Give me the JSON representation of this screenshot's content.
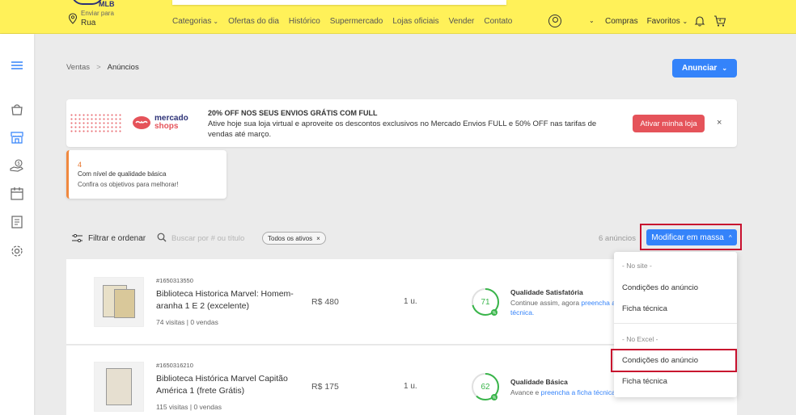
{
  "header": {
    "logo_text": "MLB",
    "location_top": "Enviar para",
    "location_bottom": "Rua",
    "nav": [
      "Categorias",
      "Ofertas do dia",
      "Histórico",
      "Supermercado",
      "Lojas oficiais",
      "Vender",
      "Contato"
    ],
    "right": [
      "Compras",
      "Favoritos"
    ],
    "background_color": "#fff159"
  },
  "breadcrumb": {
    "parent": "Ventas",
    "separator": ">",
    "current": "Anúncios"
  },
  "anunciar_label": "Anunciar",
  "banner": {
    "logo_line1": "mercado",
    "logo_line2": "shops",
    "title": "20% OFF NOS SEUS ENVIOS GRÁTIS COM FULL",
    "text": "Ative hoje sua loja virtual e aproveite os descontos exclusivos no Mercado Envios FULL e 50% OFF nas tarifas de vendas até março.",
    "button": "Ativar minha loja",
    "close": "×"
  },
  "quality_card": {
    "count": "4",
    "title": "Com nível de qualidade básica",
    "subtitle": "Confira os objetivos para melhorar!"
  },
  "filters": {
    "filter_label": "Filtrar e ordenar",
    "search_placeholder": "Buscar por # ou título",
    "chip": "Todos os ativos",
    "chip_close": "×",
    "count": "6 anúncios",
    "bulk_button": "Modificar em massa"
  },
  "listings": [
    {
      "id": "#1650313550",
      "title": "Biblioteca Historica Marvel: Homem-aranha 1 E 2 (excelente)",
      "stats": "74 visitas | 0 vendas",
      "price": "R$ 480",
      "units": "1 u.",
      "score": "71",
      "quality_title": "Qualidade Satisfatória",
      "quality_text_pre": "Continue assim, agora ",
      "quality_link": "preencha a ficha",
      "quality_text_line2": "técnica."
    },
    {
      "id": "#1650316210",
      "title": "Biblioteca Histórica Marvel Capitão América 1 (frete Grátis)",
      "stats": "115 visitas | 0 vendas",
      "price": "R$ 175",
      "units": "1 u.",
      "score": "62",
      "quality_title": "Qualidade Básica",
      "quality_text_pre": "Avance e ",
      "quality_link": "preencha a ficha técnica",
      "quality_text_line2": ""
    }
  ],
  "dropdown": {
    "section1_header": "- No site -",
    "section1_items": [
      "Condições do anúncio",
      "Ficha técnica"
    ],
    "section2_header": "- No Excel -",
    "section2_items": [
      "Condições do anúncio",
      "Ficha técnica"
    ]
  },
  "colors": {
    "accent_blue": "#3483fa",
    "highlight_red": "#c8102e",
    "score_green": "#39b54a",
    "banner_button": "#e5535a"
  }
}
